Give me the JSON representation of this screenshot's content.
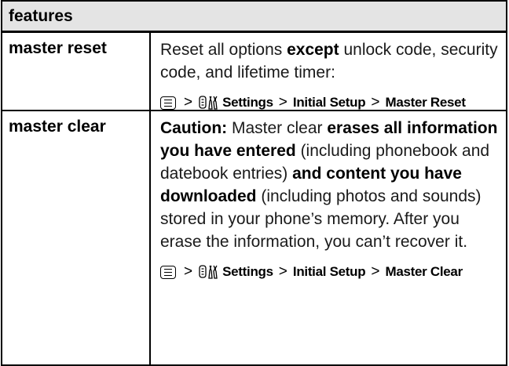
{
  "table": {
    "header": "features",
    "rows": [
      {
        "label": "master reset",
        "desc_parts": [
          {
            "t": "Reset all options ",
            "b": false
          },
          {
            "t": "except",
            "b": true
          },
          {
            "t": " unlock code, security code, and lifetime timer:",
            "b": false
          }
        ],
        "path": {
          "step1": "Settings",
          "step2": "Initial Setup",
          "step3": "Master Reset"
        }
      },
      {
        "label": "master clear",
        "desc_parts": [
          {
            "t": "Caution:",
            "b": true
          },
          {
            "t": " Master clear ",
            "b": false
          },
          {
            "t": "erases all information you have entered",
            "b": true
          },
          {
            "t": " (including phonebook and datebook entries) ",
            "b": false
          },
          {
            "t": "and content you have downloaded",
            "b": true
          },
          {
            "t": " (including photos and sounds) stored in your phone’s memory. After you erase the information, you can’t recover it.",
            "b": false
          }
        ],
        "path": {
          "step1": "Settings",
          "step2": "Initial Setup",
          "step3": "Master Clear"
        }
      }
    ],
    "separator": ">"
  },
  "icons": {
    "menu_key": "menu-key-icon",
    "settings": "settings-icon"
  }
}
